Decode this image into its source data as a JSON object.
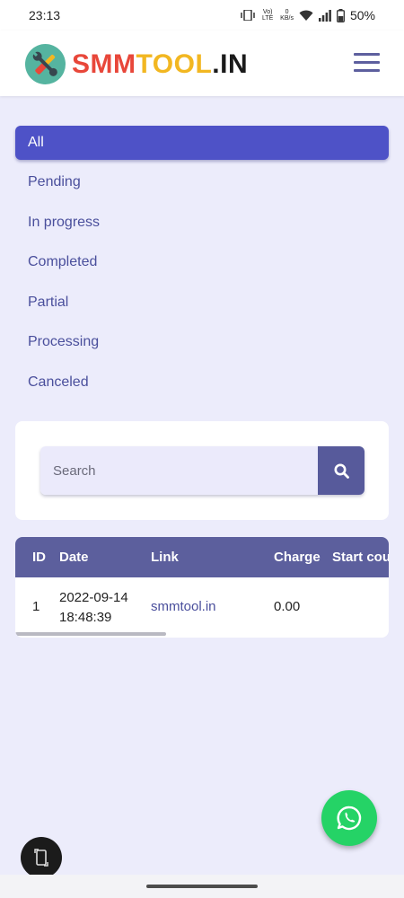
{
  "status": {
    "time": "23:13",
    "network_label": "Vo) LTE",
    "speed_value": "0",
    "speed_unit": "KB/s",
    "battery": "50%"
  },
  "brand": {
    "name_part1": "SMM",
    "name_part2": "TOOL",
    "name_part3": ".IN",
    "colors": {
      "red": "#e8473a",
      "yellow": "#f2b721",
      "dark": "#1a1a1a",
      "teal": "#55b4a0"
    }
  },
  "filters": [
    {
      "label": "All",
      "active": true
    },
    {
      "label": "Pending"
    },
    {
      "label": "In progress"
    },
    {
      "label": "Completed"
    },
    {
      "label": "Partial"
    },
    {
      "label": "Processing"
    },
    {
      "label": "Canceled"
    }
  ],
  "search": {
    "placeholder": "Search",
    "icon": "search-icon"
  },
  "table": {
    "columns": [
      "ID",
      "Date",
      "Link",
      "Charge",
      "Start cou"
    ],
    "rows": [
      {
        "id": "1",
        "date": "2022-09-14",
        "time": "18:48:39",
        "link": "smmtool.in",
        "charge": "0.00"
      }
    ]
  },
  "icons": {
    "whatsapp": "whatsapp-icon",
    "rotate": "rotate-screen-icon",
    "menu": "hamburger-menu-icon"
  },
  "theme": {
    "accent": "#4e52c7",
    "header_bar": "#5c5f9d",
    "background": "#ececfb",
    "whatsapp": "#25d366"
  }
}
